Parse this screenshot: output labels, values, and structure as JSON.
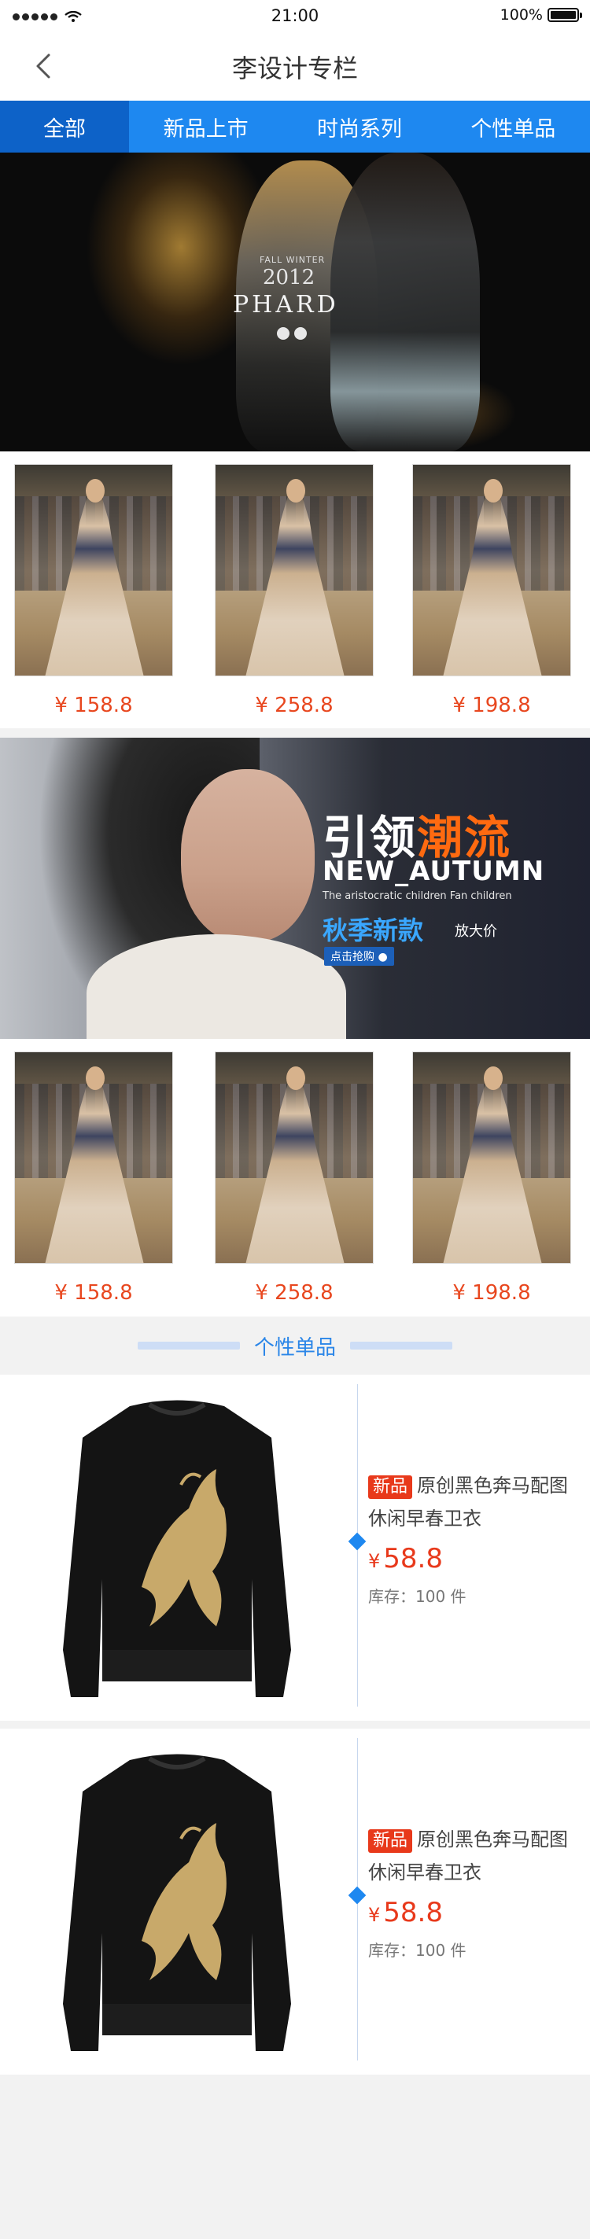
{
  "status_bar": {
    "time": "21:00",
    "battery": "100%",
    "battery_level": 1.0
  },
  "nav": {
    "title": "李设计专栏"
  },
  "tabs": [
    {
      "label": "全部",
      "active": true
    },
    {
      "label": "新品上市",
      "active": false
    },
    {
      "label": "时尚系列",
      "active": false
    },
    {
      "label": "个性单品",
      "active": false
    }
  ],
  "banner1": {
    "season": "FALL WINTER",
    "year": "2012",
    "brand": "PHARD"
  },
  "grid1": {
    "products": [
      {
        "price": "¥ 158.8"
      },
      {
        "price": "¥ 258.8"
      },
      {
        "price": "¥ 198.8"
      }
    ]
  },
  "banner2": {
    "headline_a": "引领",
    "headline_b": "潮流",
    "headline_en": "NEW_AUTUMN",
    "subline": "The aristocratic children Fan children",
    "autumn": "秋季新款",
    "discount": "放大价",
    "cta": "点击抢购 ●"
  },
  "grid2": {
    "products": [
      {
        "price": "¥ 158.8"
      },
      {
        "price": "¥ 258.8"
      },
      {
        "price": "¥ 198.8"
      }
    ]
  },
  "section": {
    "title": "个性单品"
  },
  "features": [
    {
      "tag": "新品",
      "name": "原创黑色奔马配图休闲早春卫衣",
      "currency": "¥",
      "price": "58.8",
      "stock": "库存：100 件"
    },
    {
      "tag": "新品",
      "name": "原创黑色奔马配图休闲早春卫衣",
      "currency": "¥",
      "price": "58.8",
      "stock": "库存：100 件"
    }
  ],
  "colors": {
    "tab_bg": "#1e88f0",
    "tab_active": "#0d62c8",
    "price": "#e8471f",
    "tag": "#e8391b",
    "section": "#2b86e8"
  },
  "icons": {
    "back": "chevron-left-icon",
    "wifi": "wifi-icon",
    "battery": "battery-icon"
  }
}
